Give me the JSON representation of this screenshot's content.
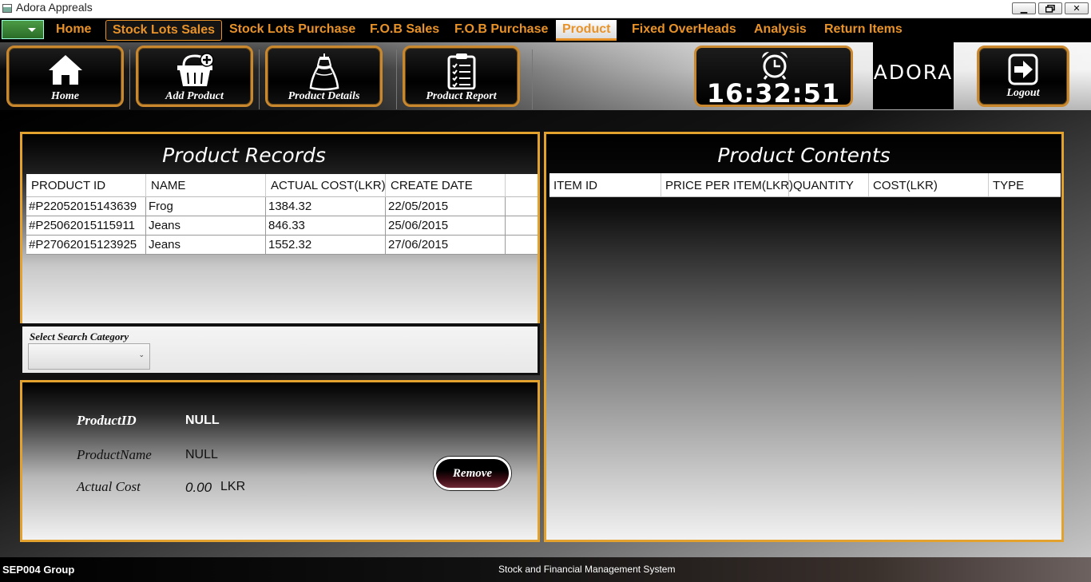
{
  "window": {
    "title": "Adora Appreals",
    "minimize": "▁",
    "maximize": "🗗",
    "close": "✕"
  },
  "menu": {
    "items": [
      "Home",
      "Stock Lots Sales",
      "Stock Lots Purchase",
      "F.O.B Sales",
      "F.O.B Purchase",
      "Product",
      "Fixed OverHeads",
      "Analysis",
      "Return Items"
    ],
    "active": "Product"
  },
  "toolbar": {
    "home": "Home",
    "add_product": "Add Product",
    "product_details": "Product Details",
    "product_report": "Product Report",
    "clock_time": "16:32:51",
    "logo": "ADORA",
    "logout": "Logout"
  },
  "records": {
    "title": "Product Records",
    "columns": [
      "PRODUCT ID",
      "NAME",
      "ACTUAL COST(LKR)",
      "CREATE DATE"
    ],
    "rows": [
      [
        "#P22052015143639",
        "Frog",
        "1384.32",
        "22/05/2015"
      ],
      [
        "#P25062015115911",
        "Jeans",
        "846.33",
        "25/06/2015"
      ],
      [
        "#P27062015123925",
        "Jeans",
        "1552.32",
        "27/06/2015"
      ]
    ]
  },
  "search": {
    "label": "Select Search Category",
    "selected": ""
  },
  "detail": {
    "id_label": "ProductID",
    "id_value": "NULL",
    "name_label": "ProductName",
    "name_value": "NULL",
    "cost_label": "Actual Cost",
    "cost_value": "0.00",
    "cost_unit": "LKR",
    "remove": "Remove"
  },
  "contents": {
    "title": "Product Contents",
    "columns": [
      "ITEM ID",
      "PRICE PER ITEM(LKR)",
      "QUANTITY",
      "COST(LKR)",
      "TYPE"
    ]
  },
  "footer": {
    "group": "SEP004 Group",
    "system": "Stock and Financial Management System"
  }
}
